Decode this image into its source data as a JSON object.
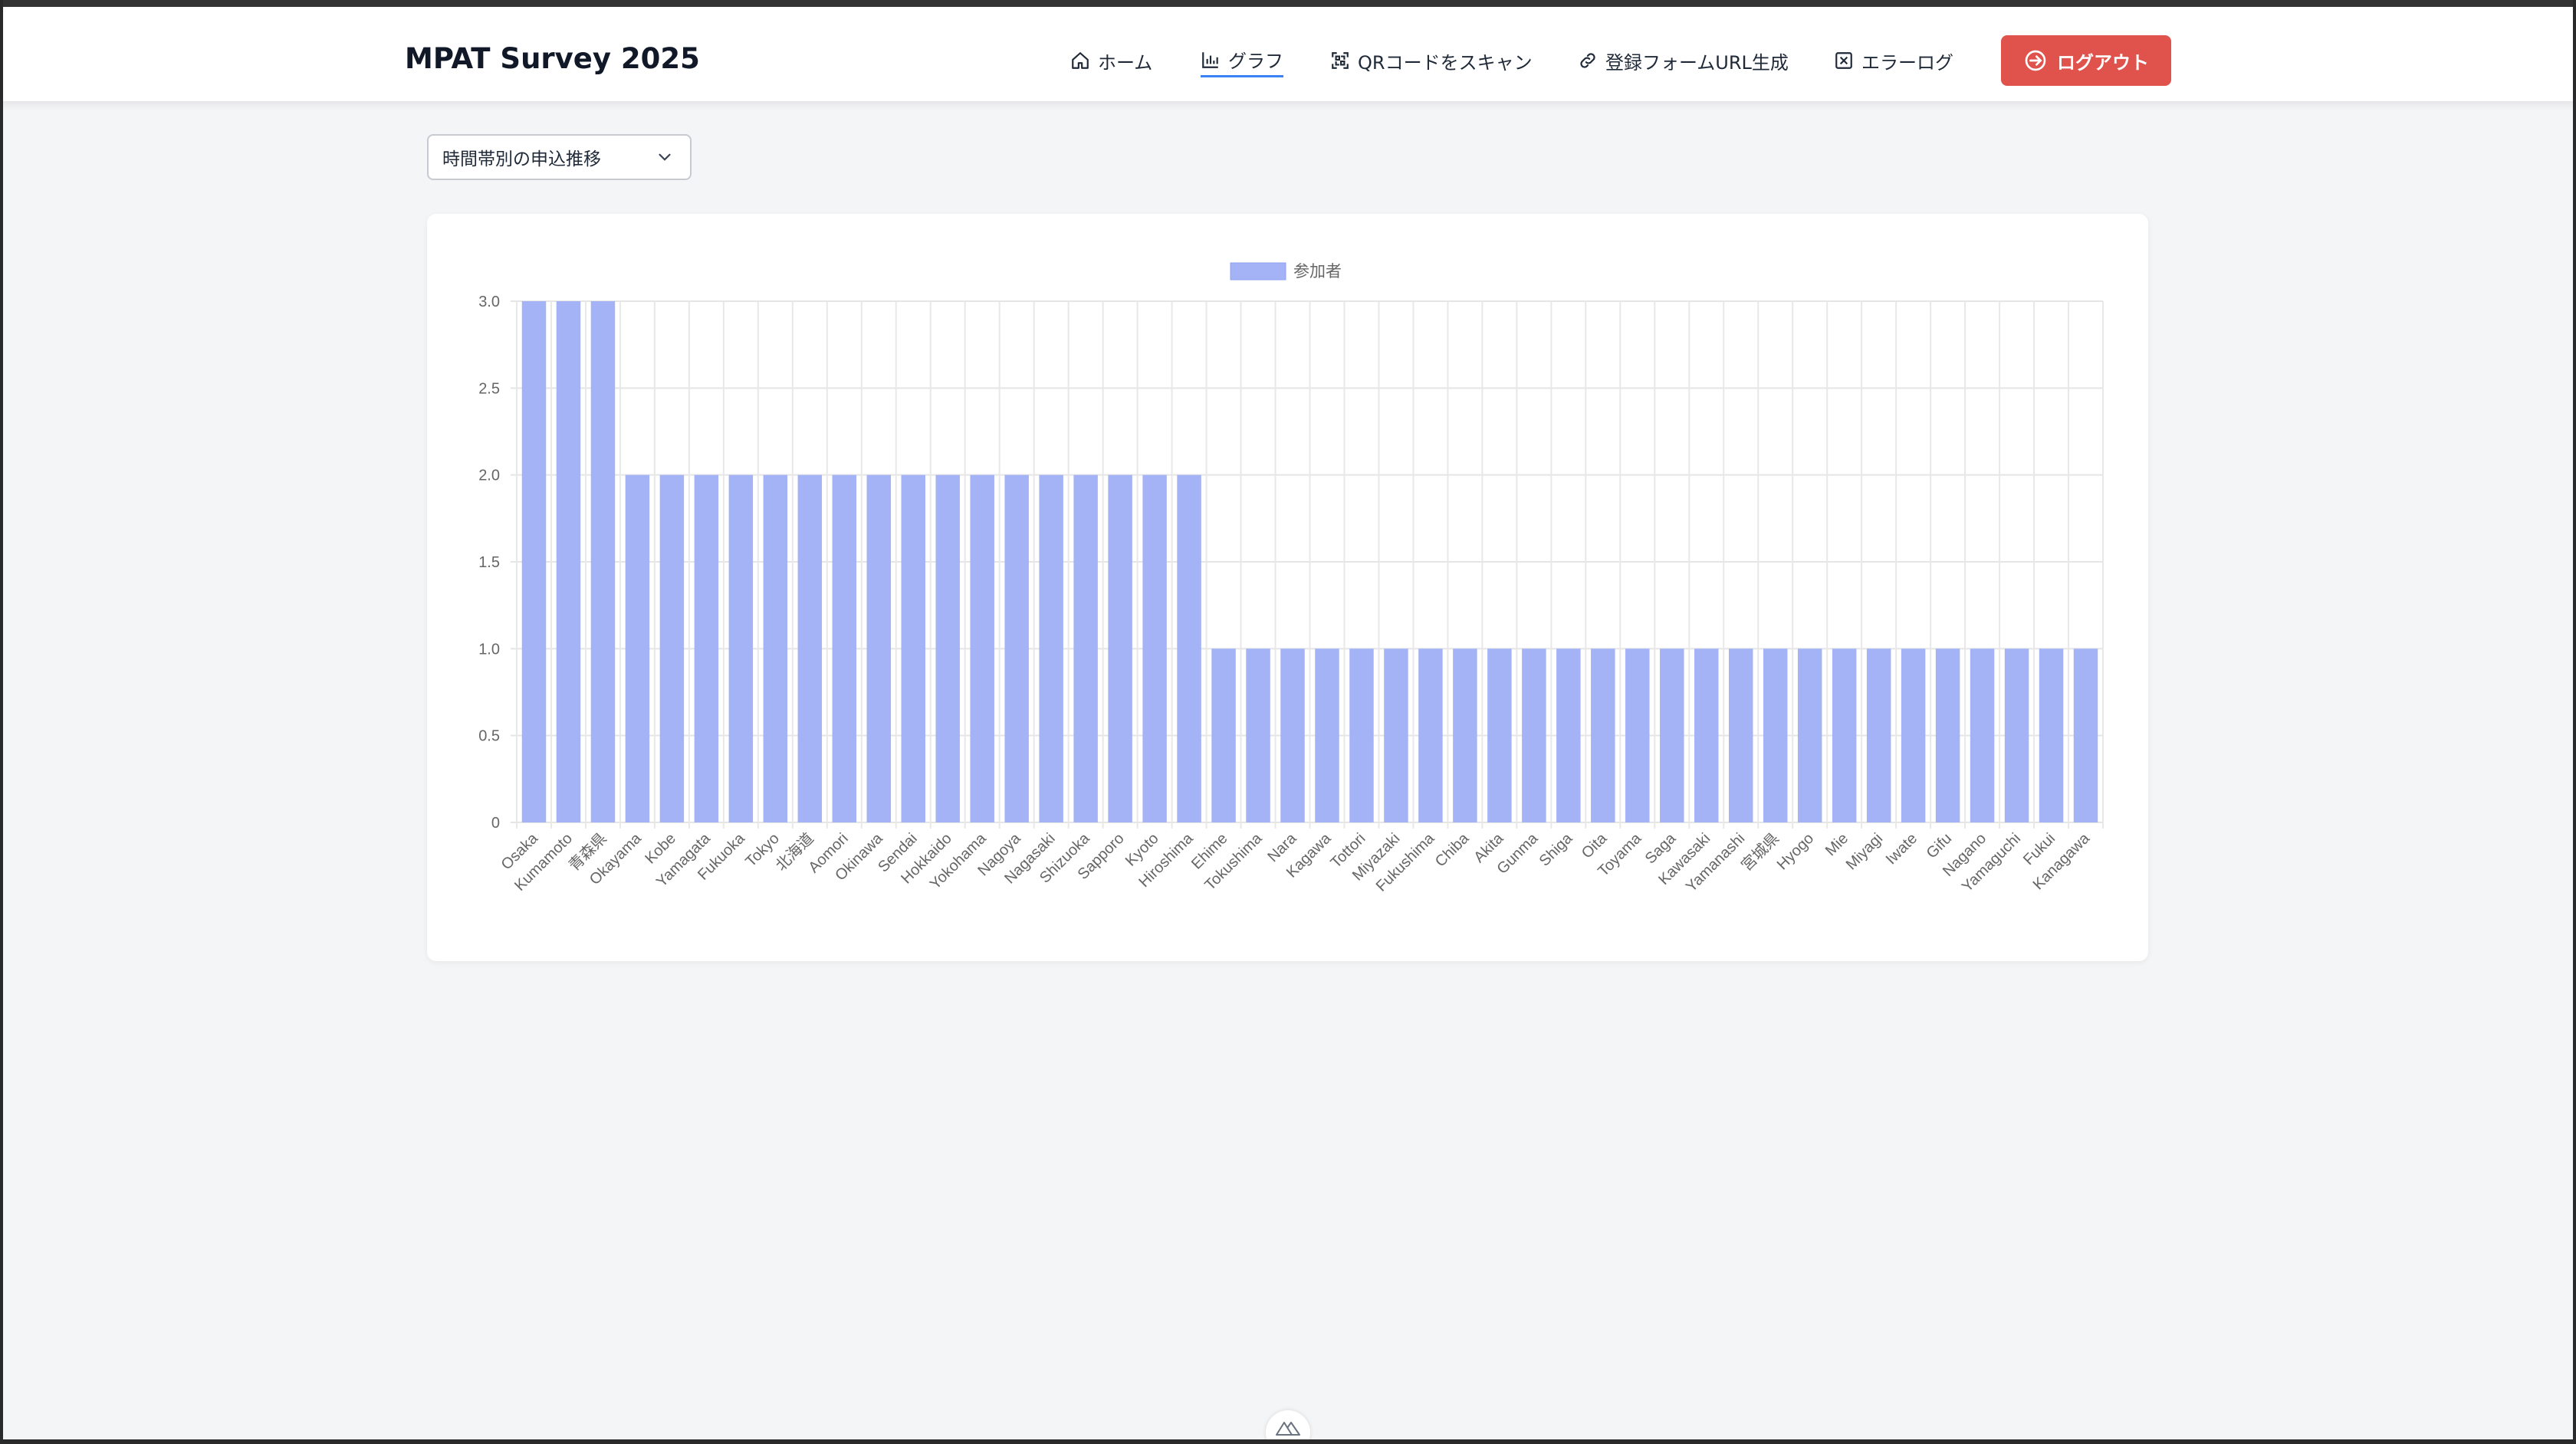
{
  "app": {
    "title": "MPAT Survey 2025"
  },
  "nav": {
    "home": "ホーム",
    "graph": "グラフ",
    "qr": "QRコードをスキャン",
    "form_url": "登録フォームURL生成",
    "error_log": "エラーログ",
    "logout": "ログアウト"
  },
  "chart_select": {
    "value": "時間帯別の申込推移"
  },
  "colors": {
    "accent": "#3b82f6",
    "logout": "#e0534c",
    "bar": "#a3b3f5"
  },
  "chart_data": {
    "type": "bar",
    "title": "",
    "xlabel": "",
    "ylabel": "",
    "ylim": [
      0,
      3
    ],
    "yticks": [
      "0",
      "0.5",
      "1.0",
      "1.5",
      "2.0",
      "2.5",
      "3.0"
    ],
    "grid": true,
    "legend_position": "top",
    "categories": [
      "Osaka",
      "Kumamoto",
      "青森県",
      "Okayama",
      "Kobe",
      "Yamagata",
      "Fukuoka",
      "Tokyo",
      "北海道",
      "Aomori",
      "Okinawa",
      "Sendai",
      "Hokkaido",
      "Yokohama",
      "Nagoya",
      "Nagasaki",
      "Shizuoka",
      "Sapporo",
      "Kyoto",
      "Hiroshima",
      "Ehime",
      "Tokushima",
      "Nara",
      "Kagawa",
      "Tottori",
      "Miyazaki",
      "Fukushima",
      "Chiba",
      "Akita",
      "Gunma",
      "Shiga",
      "Oita",
      "Toyama",
      "Saga",
      "Kawasaki",
      "Yamanashi",
      "宮城県",
      "Hyogo",
      "Mie",
      "Miyagi",
      "Iwate",
      "Gifu",
      "Nagano",
      "Yamaguchi",
      "Fukui",
      "Kanagawa"
    ],
    "series": [
      {
        "name": "参加者",
        "values": [
          3,
          3,
          3,
          2,
          2,
          2,
          2,
          2,
          2,
          2,
          2,
          2,
          2,
          2,
          2,
          2,
          2,
          2,
          2,
          2,
          1,
          1,
          1,
          1,
          1,
          1,
          1,
          1,
          1,
          1,
          1,
          1,
          1,
          1,
          1,
          1,
          1,
          1,
          1,
          1,
          1,
          1,
          1,
          1,
          1,
          1
        ]
      }
    ]
  }
}
